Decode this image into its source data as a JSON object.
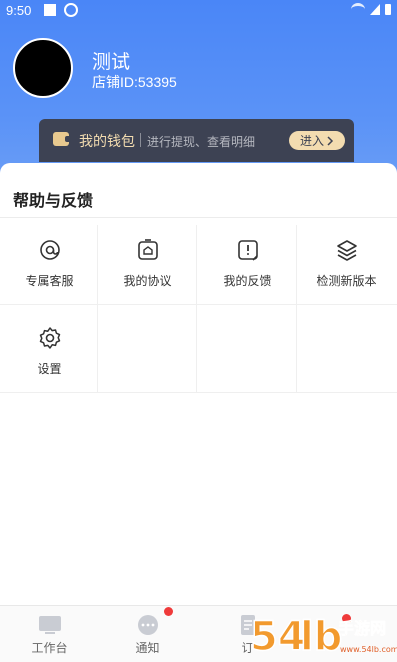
{
  "status_bar": {
    "time": "9:50"
  },
  "profile": {
    "name": "测试",
    "shop_id": "店铺ID:53395"
  },
  "wallet": {
    "title": "我的钱包",
    "subtitle": "进行提现、查看明细",
    "enter_label": "进入"
  },
  "help_section": {
    "title": "帮助与反馈",
    "items": [
      {
        "label": "专属客服",
        "icon": "at-icon"
      },
      {
        "label": "我的协议",
        "icon": "agreement-icon"
      },
      {
        "label": "我的反馈",
        "icon": "feedback-icon"
      },
      {
        "label": "检测新版本",
        "icon": "layers-icon"
      },
      {
        "label": "设置",
        "icon": "gear-icon"
      }
    ]
  },
  "tabbar": {
    "tabs": [
      {
        "label": "工作台",
        "icon": "workbench-icon"
      },
      {
        "label": "通知",
        "icon": "chat-bubble-icon"
      },
      {
        "label": "订",
        "icon": "order-icon"
      }
    ]
  },
  "watermark": {
    "text": "54lb手游网",
    "url": "www.54lb.com"
  },
  "colors": {
    "header_blue": "#4a86f7",
    "wallet_dark": "#3d4253",
    "wallet_gold": "#f3dcb0",
    "badge_red": "#ef3a3a"
  }
}
